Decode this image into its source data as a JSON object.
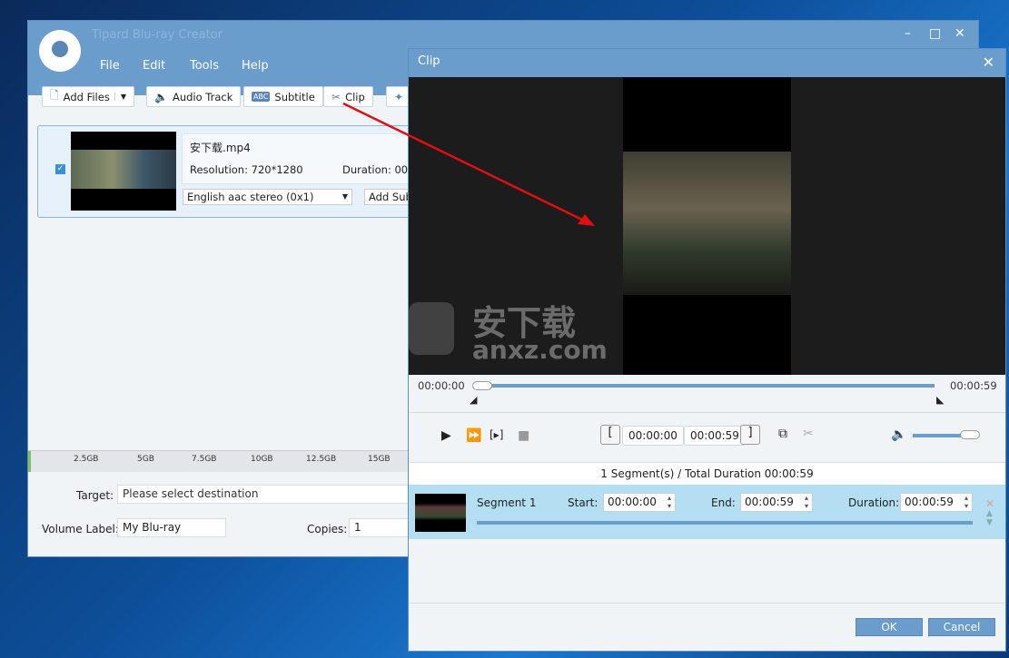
{
  "main_window": {
    "title": "Tipard Blu-ray Creator",
    "menu": [
      "File",
      "Edit",
      "Tools",
      "Help"
    ],
    "toolbar": {
      "add_files": "Add Files",
      "audio_track": "Audio Track",
      "subtitle": "Subtitle",
      "subtitle_badge": "ABC",
      "clip": "Clip"
    },
    "file": {
      "name": "安下载.mp4",
      "resolution_label": "Resolution:",
      "resolution": "720*1280",
      "duration_label": "Duration:",
      "duration": "00:",
      "audio": "English aac stereo (0x1)",
      "add_subtitle": "Add Sub",
      "checked": true
    },
    "ruler": [
      "2.5GB",
      "5GB",
      "7.5GB",
      "10GB",
      "12.5GB",
      "15GB"
    ],
    "target_label": "Target:",
    "target_placeholder": "Please select destination",
    "volume_label": "Volume Label:",
    "volume_value": "My Blu-ray",
    "copies_label": "Copies:",
    "copies_value": "1"
  },
  "clip_dialog": {
    "title": "Clip",
    "watermark": {
      "cn": "安下载",
      "en": "anxz.com"
    },
    "timeline": {
      "start": "00:00:00",
      "end": "00:00:59",
      "progress": 0
    },
    "set_start": "00:00:00",
    "set_end": "00:00:59",
    "volume": 0.85,
    "summary": "1 Segment(s) / Total Duration 00:00:59",
    "segment": {
      "name": "Segment 1",
      "start_label": "Start:",
      "start": "00:00:00",
      "end_label": "End:",
      "end": "00:00:59",
      "duration_label": "Duration:",
      "duration": "00:00:59"
    },
    "ok": "OK",
    "cancel": "Cancel"
  }
}
